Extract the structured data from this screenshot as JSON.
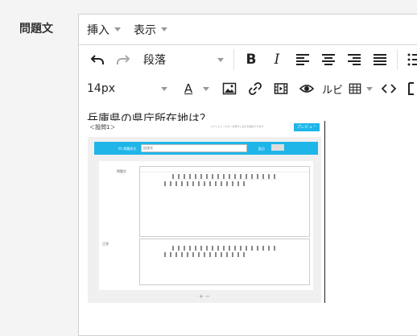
{
  "field_label": "問題文",
  "menubar": {
    "insert": "挿入",
    "table": "表示"
  },
  "toolbar1": {
    "format_select": "段落"
  },
  "toolbar2": {
    "font_size": "14px",
    "text_color": "A",
    "ruby": "ルビ"
  },
  "content": {
    "question": "兵庫県の県庁所在地は？"
  },
  "embedded": {
    "question_num": "＜設問1＞",
    "preview_button": "プレビュー",
    "note": "※プレビューボタンを押すと表示を確認できます",
    "top_label": "01 問題形式",
    "top_select": "記述式",
    "score_label": "配点",
    "section1_label": "問題文",
    "section2_label": "正答",
    "footer_controls": "+ −"
  },
  "colors": {
    "accent": "#1fb5e8",
    "text": "#222222"
  }
}
